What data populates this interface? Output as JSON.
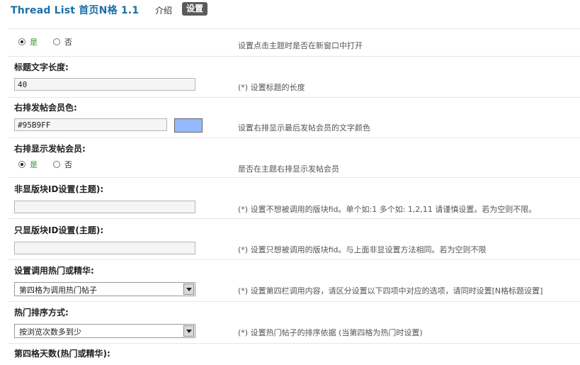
{
  "header": {
    "title": "Thread List 首页N格 1.1",
    "tab_intro": "介绍",
    "tab_settings": "设置"
  },
  "options": {
    "yes_label": "是",
    "no_label": "否"
  },
  "settings": {
    "new_window": {
      "selected": "yes",
      "desc": "设置点击主题时是否在新窗口中打开"
    },
    "title_length": {
      "label": "标题文字长度:",
      "value": "40",
      "desc": "(*) 设置标题的长度"
    },
    "poster_color": {
      "label": "右排发帖会员色:",
      "value": "#95B9FF",
      "swatch_color": "#95B9FF",
      "desc": "设置右排显示最后发帖会员的文字颜色"
    },
    "show_poster": {
      "label": "右排显示发帖会员:",
      "selected": "yes",
      "desc": "是否在主题右排显示发帖会员"
    },
    "exclude_forums": {
      "label": "非显版块ID设置(主题):",
      "value": "",
      "desc": "(*) 设置不想被调用的版块fid。单个如:1 多个如: 1,2,11 请谨慎设置。若为空则不限。"
    },
    "only_forums": {
      "label": "只显版块ID设置(主题):",
      "value": "",
      "desc": "(*) 设置只想被调用的版块fid。与上面非显设置方法相同。若为空则不限"
    },
    "hot_or_digest": {
      "label": "设置调用热门或精华:",
      "selected": "第四格为调用热门帖子",
      "desc": "(*) 设置第四栏调用内容，请区分设置以下四项中对应的选项，请同时设置[N格标题设置]"
    },
    "hot_sort": {
      "label": "热门排序方式:",
      "selected": "按浏览次数多到少",
      "desc": "(*) 设置热门帖子的排序依据 (当第四格为热门时设置)"
    },
    "fourth_days": {
      "label": "第四格天数(热门或精华):"
    }
  }
}
